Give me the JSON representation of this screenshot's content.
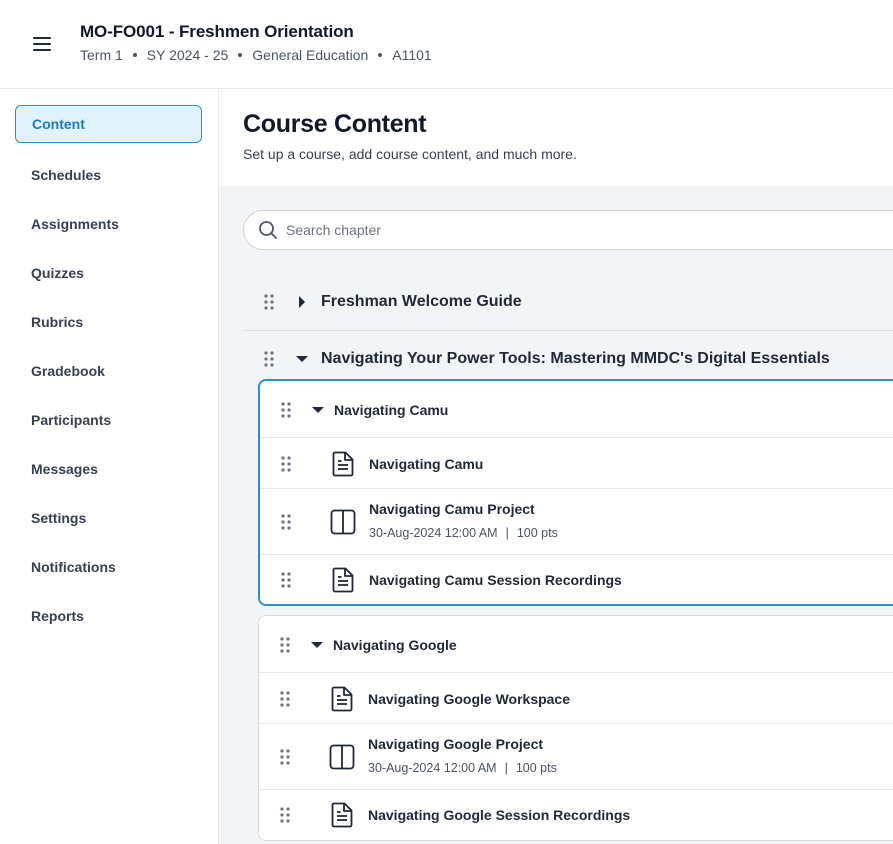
{
  "header": {
    "course_title": "MO-FO001 - Freshmen Orientation",
    "meta": [
      "Term 1",
      "SY 2024 - 25",
      "General Education",
      "A1101"
    ]
  },
  "sidebar": {
    "items": [
      {
        "label": "Content",
        "active": true
      },
      {
        "label": "Schedules"
      },
      {
        "label": "Assignments"
      },
      {
        "label": "Quizzes"
      },
      {
        "label": "Rubrics"
      },
      {
        "label": "Gradebook"
      },
      {
        "label": "Participants"
      },
      {
        "label": "Messages"
      },
      {
        "label": "Settings"
      },
      {
        "label": "Notifications"
      },
      {
        "label": "Reports"
      }
    ]
  },
  "main": {
    "title": "Course Content",
    "subtitle": "Set up a course, add course content, and much more.",
    "search": {
      "placeholder": "Search chapter"
    },
    "chapters": [
      {
        "title": "Freshman Welcome Guide",
        "expanded": false
      },
      {
        "title": "Navigating Your Power Tools: Mastering MMDC's Digital Essentials",
        "expanded": true,
        "sections": [
          {
            "title": "Navigating Camu",
            "items": [
              {
                "title": "Navigating Camu",
                "icon": "document-icon"
              },
              {
                "title": "Navigating Camu Project",
                "icon": "assignment-icon",
                "due": "30-Aug-2024 12:00 AM",
                "points": "100 pts"
              },
              {
                "title": "Navigating Camu Session Recordings",
                "icon": "document-icon"
              }
            ]
          },
          {
            "title": "Navigating Google",
            "items": [
              {
                "title": "Navigating Google Workspace",
                "icon": "document-icon"
              },
              {
                "title": "Navigating Google Project",
                "icon": "assignment-icon",
                "due": "30-Aug-2024 12:00 AM",
                "points": "100 pts"
              },
              {
                "title": "Navigating Google Session Recordings",
                "icon": "document-icon"
              }
            ]
          }
        ]
      }
    ]
  },
  "colors": {
    "accent": "#2e8fcf",
    "active_bg": "#e0f2fb",
    "content_bg": "#f3f4f6"
  }
}
